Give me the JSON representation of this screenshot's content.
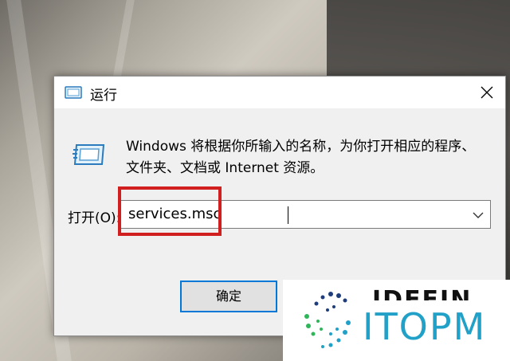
{
  "dialog": {
    "title": "运行",
    "description_line1": "Windows 将根据你所输入的名称，为你打开相应的程序、",
    "description_line2": "文件夹、文档或 Internet 资源。",
    "open_label": "打开(O):",
    "command_value": "services.msc",
    "ok_label": "确定"
  },
  "watermark": {
    "brand": "ITOPM",
    "partial_text": "IDEEIN"
  },
  "colors": {
    "highlight": "#d11f1f",
    "focus_border": "#0078d7",
    "brand": "#21a0c8"
  },
  "icons": {
    "title": "run-icon",
    "large": "run-icon",
    "close": "close-icon",
    "dropdown": "chevron-down-icon"
  }
}
